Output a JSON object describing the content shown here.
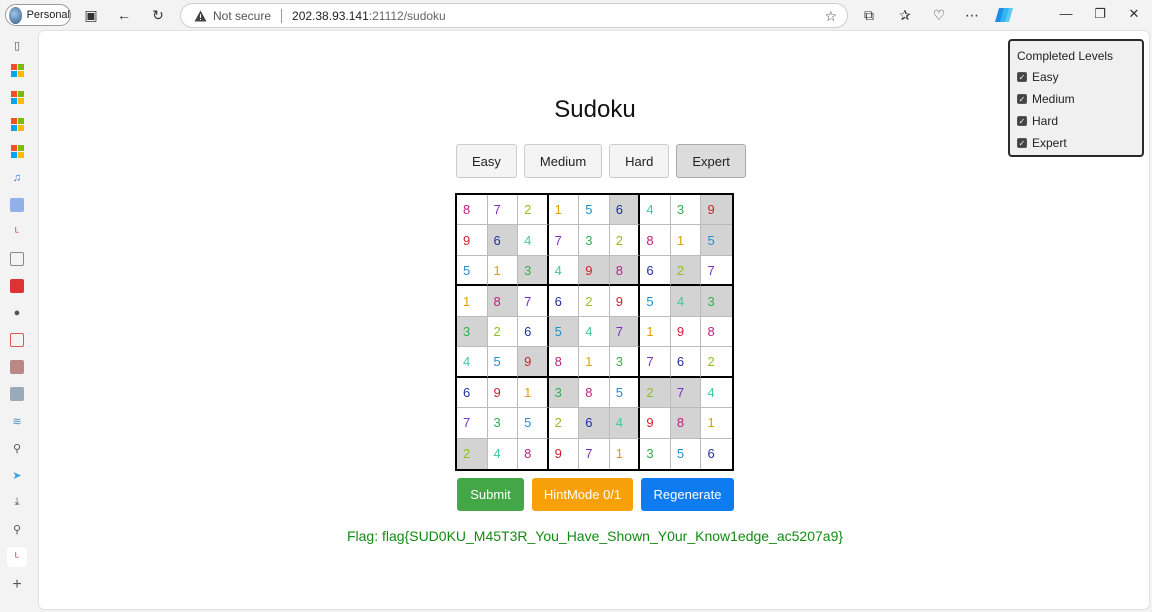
{
  "browser": {
    "profile_label": "Personal",
    "not_secure": "Not secure",
    "url_host": "202.38.93.141",
    "url_path": ":21112/sudoku"
  },
  "page": {
    "title": "Sudoku",
    "levels": [
      "Easy",
      "Medium",
      "Hard",
      "Expert"
    ],
    "active_level": "Expert",
    "buttons": {
      "submit": "Submit",
      "hint": "HintMode 0/1",
      "regenerate": "Regenerate"
    },
    "flag": "Flag: flag{SUD0KU_M45T3R_You_Have_Shown_Y0ur_Know1edge_ac5207a9}",
    "completed": {
      "title": "Completed Levels",
      "items": [
        "Easy",
        "Medium",
        "Hard",
        "Expert"
      ]
    }
  },
  "board": {
    "values": [
      [
        8,
        7,
        2,
        1,
        5,
        6,
        4,
        3,
        9
      ],
      [
        9,
        6,
        4,
        7,
        3,
        2,
        8,
        1,
        5
      ],
      [
        5,
        1,
        3,
        4,
        9,
        8,
        6,
        2,
        7
      ],
      [
        1,
        8,
        7,
        6,
        2,
        9,
        5,
        4,
        3
      ],
      [
        3,
        2,
        6,
        5,
        4,
        7,
        1,
        9,
        8
      ],
      [
        4,
        5,
        9,
        8,
        1,
        3,
        7,
        6,
        2
      ],
      [
        6,
        9,
        1,
        3,
        8,
        5,
        2,
        7,
        4
      ],
      [
        7,
        3,
        5,
        2,
        6,
        4,
        9,
        8,
        1
      ],
      [
        2,
        4,
        8,
        9,
        7,
        1,
        3,
        5,
        6
      ]
    ],
    "given": [
      [
        0,
        0,
        0,
        0,
        0,
        1,
        0,
        0,
        1
      ],
      [
        0,
        1,
        0,
        0,
        0,
        0,
        0,
        0,
        1
      ],
      [
        0,
        0,
        1,
        0,
        1,
        1,
        0,
        1,
        0
      ],
      [
        0,
        1,
        0,
        0,
        0,
        0,
        0,
        1,
        1
      ],
      [
        1,
        0,
        0,
        1,
        0,
        1,
        0,
        0,
        0
      ],
      [
        0,
        0,
        1,
        0,
        0,
        0,
        0,
        0,
        0
      ],
      [
        0,
        0,
        0,
        1,
        0,
        0,
        1,
        1,
        0
      ],
      [
        0,
        0,
        0,
        0,
        1,
        1,
        0,
        1,
        0
      ],
      [
        1,
        0,
        0,
        0,
        0,
        0,
        0,
        0,
        0
      ]
    ],
    "digit_colors": {
      "1": "#e0a000",
      "2": "#90c020",
      "3": "#30b050",
      "4": "#40c8a0",
      "5": "#2090d0",
      "6": "#2030a0",
      "7": "#8030c0",
      "8": "#c02080",
      "9": "#d02030"
    }
  }
}
